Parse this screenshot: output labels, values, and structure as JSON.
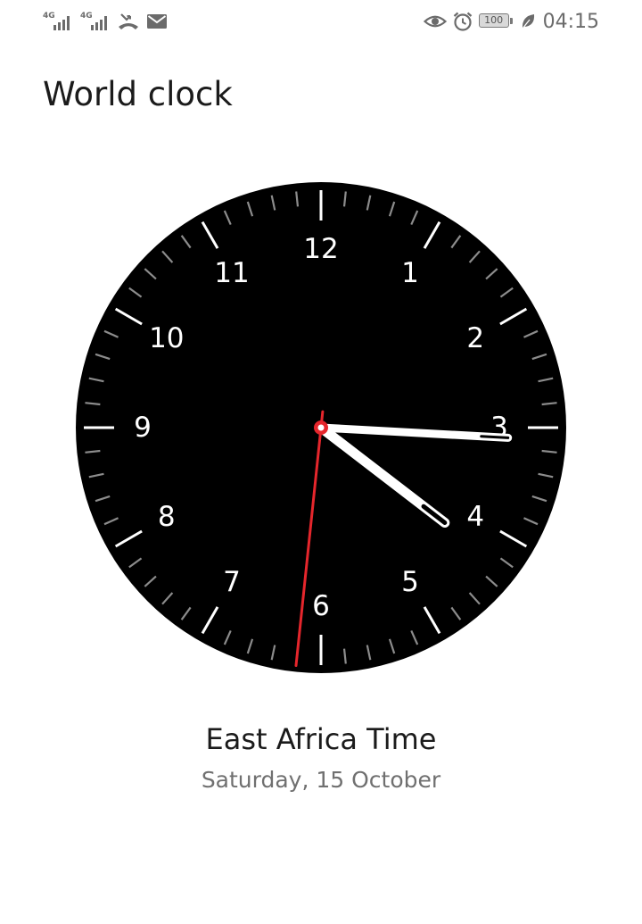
{
  "status_bar": {
    "network_1": "4G",
    "network_2": "4G",
    "battery": "100",
    "time": "04:15",
    "icons": {
      "signal_1": "signal-bars-icon",
      "signal_2": "signal-bars-icon",
      "missed_call": "missed-call-icon",
      "mail": "mail-icon",
      "eye_comfort": "eye-icon",
      "alarm": "alarm-icon",
      "battery": "battery-icon",
      "power_saving": "leaf-icon"
    },
    "icon_color": "#6b6b6b"
  },
  "page": {
    "title": "World clock"
  },
  "clock": {
    "numerals": [
      "12",
      "1",
      "2",
      "3",
      "4",
      "5",
      "6",
      "7",
      "8",
      "9",
      "10",
      "11"
    ],
    "time": {
      "hours": 4,
      "minutes": 15,
      "seconds": 31
    },
    "face_color": "#000000",
    "hand_color": "#ffffff",
    "second_hand_color": "#e5262c"
  },
  "location": {
    "city": "East Africa Time",
    "date": "Saturday, 15 October"
  }
}
